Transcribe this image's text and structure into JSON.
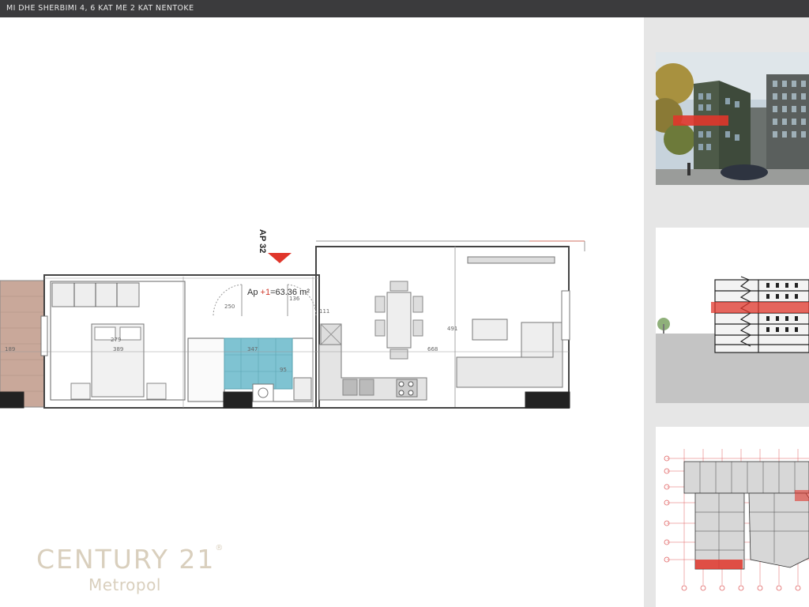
{
  "header": {
    "title": "MI DHE SHERBIMI  4, 6 KAT ME 2 KAT NENTOKE"
  },
  "plan": {
    "apartment_label": "AP 32",
    "area_prefix": "Ap",
    "area_sep": "+1",
    "area_value": "=63.36 m²",
    "dims": [
      "189",
      "279",
      "389",
      "347",
      "95",
      "136",
      "111",
      "250",
      "491",
      "668"
    ]
  },
  "brand": {
    "name": "CENTURY 21",
    "reg": "®",
    "office": "Metropol"
  },
  "thumbnails": [
    {
      "name": "building-render-photo"
    },
    {
      "name": "building-section-drawing"
    },
    {
      "name": "typical-floor-plan-drawing"
    }
  ],
  "colors": {
    "topbar": "#3b3b3d",
    "sidebar": "#e6e6e6",
    "highlight_red": "#e0362b",
    "bathroom_tile": "#7fc3d2",
    "balcony_wood": "#c9a89a",
    "brand_text": "#d9cfbd"
  }
}
